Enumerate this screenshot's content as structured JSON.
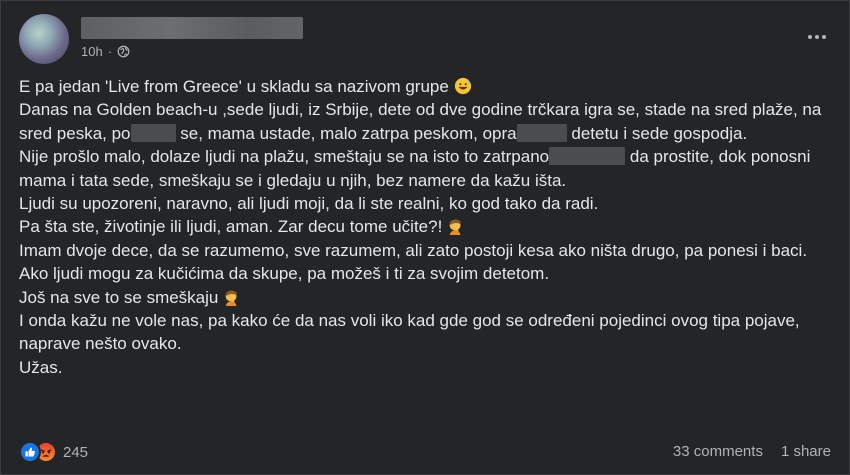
{
  "post": {
    "timestamp": "10h",
    "separator": "·",
    "audience_icon": "globe-icon",
    "more_icon": "more-horizontal-icon",
    "lines": {
      "l1": "E pa jedan 'Live from Greece' u skladu sa nazivom grupe",
      "l2a": "Danas na Golden beach-u ,sede ljudi, iz Srbije, dete od dve godine trčkara igra se, stade na sred plaže, na sred peska, po",
      "l2b": "se, mama ustade, malo zatrpa peskom, opra",
      "l2c": "detetu i sede gospodja.",
      "l3a": "Nije prošlo malo, dolaze ljudi na plažu, smeštaju se na isto to zatrpano",
      "l3b": "da prostite, dok ponosni mama i tata sede, smeškaju se i gledaju u njih, bez namere da kažu išta.",
      "l4": "Ljudi su upozoreni, naravno, ali ljudi moji, da li ste realni, ko god tako da radi.",
      "l5": "Pa šta ste, životinje ili ljudi, aman. Zar decu tome učite?!",
      "l6": "Imam dvoje dece, da se razumemo, sve razumem, ali zato postoji kesa ako ništa drugo, pa ponesi i baci. Ako ljudi mogu za kučićima da skupe, pa možeš i ti za svojim detetom.",
      "l7": "Još na sve to se smeškaju",
      "l8": "I onda kažu ne vole nas, pa kako će da nas voli iko kad gde god se određeni pojedinci ovog tipa pojave, naprave nešto ovako.",
      "l9": "Užas."
    }
  },
  "footer": {
    "reaction_count": "245",
    "comments": "33 comments",
    "shares": "1 share"
  },
  "colors": {
    "background": "#242526",
    "text": "#e4e6eb",
    "secondary_text": "#b0b3b8",
    "like_blue": "#1b74e4"
  }
}
